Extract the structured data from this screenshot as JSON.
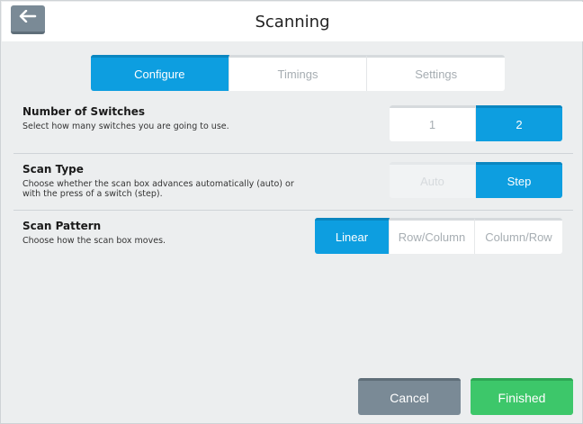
{
  "header": {
    "title": "Scanning",
    "back_icon": "arrow-left-icon"
  },
  "tabs": [
    {
      "label": "Configure",
      "active": true
    },
    {
      "label": "Timings",
      "active": false
    },
    {
      "label": "Settings",
      "active": false
    }
  ],
  "sections": {
    "switches": {
      "title": "Number of Switches",
      "description": "Select how many switches you are going to use.",
      "options": [
        "1",
        "2"
      ],
      "selected": "2"
    },
    "scan_type": {
      "title": "Scan Type",
      "description": "Choose whether the scan box advances automatically (auto) or with the press of a switch (step).",
      "options": [
        "Auto",
        "Step"
      ],
      "selected": "Step"
    },
    "scan_pattern": {
      "title": "Scan Pattern",
      "description": "Choose how the scan box moves.",
      "options": [
        "Linear",
        "Row/Column",
        "Column/Row"
      ],
      "selected": "Linear"
    }
  },
  "footer": {
    "cancel_label": "Cancel",
    "finished_label": "Finished"
  },
  "colors": {
    "accent": "#0d9ee0",
    "success": "#3dc76a",
    "neutral_button": "#7a8a96"
  }
}
